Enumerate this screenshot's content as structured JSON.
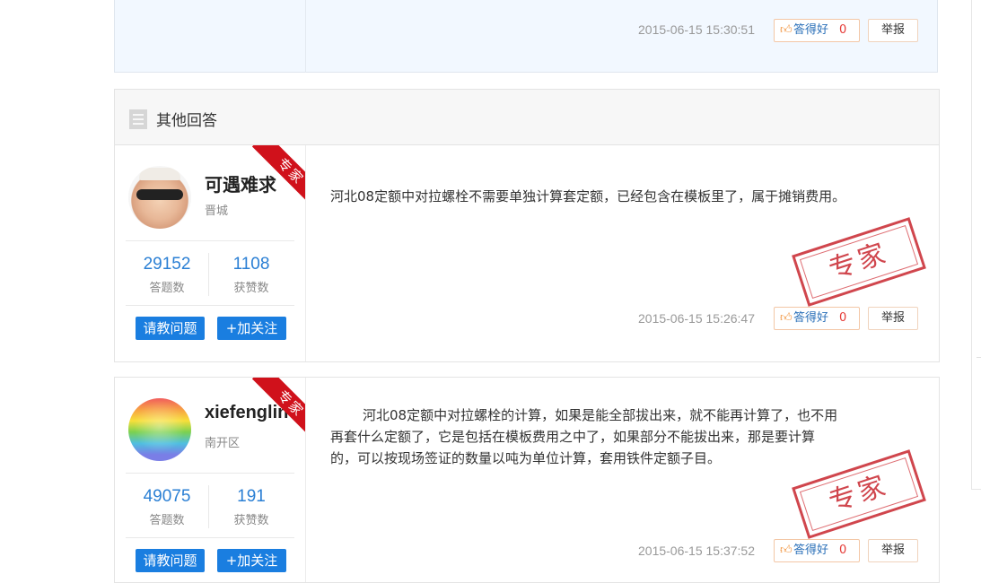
{
  "best_answer": {
    "time": "2015-06-15 15:30:51",
    "like_label": "答得好",
    "like_count": "0",
    "report_label": "举报"
  },
  "section": {
    "title": "其他回答"
  },
  "answers": [
    {
      "user": {
        "name": "可遇难求",
        "location": "晋城",
        "badge": "专家"
      },
      "stats": {
        "answers": "29152",
        "answers_label": "答题数",
        "likes": "1108",
        "likes_label": "获赞数"
      },
      "buttons": {
        "ask": "请教问题",
        "follow": "+加关注"
      },
      "text": "河北08定额中对拉螺栓不需要单独计算套定额，已经包含在模板里了，属于摊销费用。",
      "stamp": "专家",
      "time": "2015-06-15 15:26:47",
      "like_label": "答得好",
      "like_count": "0",
      "report_label": "举报"
    },
    {
      "user": {
        "name": "xiefenglin",
        "location": "南开区",
        "badge": "专家"
      },
      "stats": {
        "answers": "49075",
        "answers_label": "答题数",
        "likes": "191",
        "likes_label": "获赞数"
      },
      "buttons": {
        "ask": "请教问题",
        "follow": "+加关注"
      },
      "text_lines": [
        "河北08定额中对拉螺栓的计算，如果是能全部拔出来，就不能再计算了，也不用",
        "再套什么定额了，它是包括在模板费用之中了，如果部分不能拔出来，那是要计算",
        "的，可以按现场签证的数量以吨为单位计算，套用铁件定额子目。"
      ],
      "stamp": "专家",
      "time": "2015-06-15 15:37:52",
      "like_label": "答得好",
      "like_count": "0",
      "report_label": "举报"
    }
  ],
  "colors": {
    "accent": "#1a7ee0",
    "badge_red": "#d0111b",
    "stat_blue": "#2a7fd4"
  },
  "icons": [
    "list-icon",
    "thumbs-up-icon",
    "expert-ribbon",
    "expert-stamp"
  ]
}
